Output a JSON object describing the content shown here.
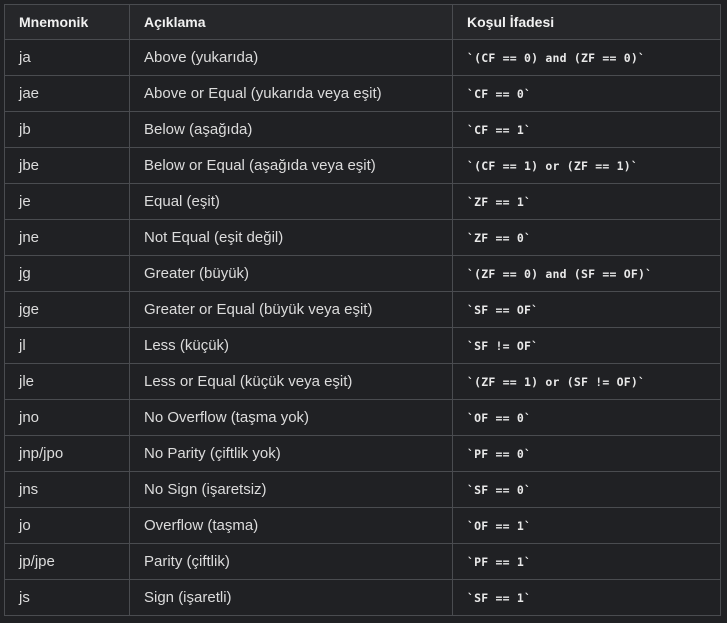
{
  "table": {
    "headers": [
      "Mnemonik",
      "Açıklama",
      "Koşul İfadesi"
    ],
    "rows": [
      [
        "ja",
        "Above (yukarıda)",
        "`(CF == 0) and (ZF == 0)`"
      ],
      [
        "jae",
        "Above or Equal (yukarıda veya eşit)",
        "`CF == 0`"
      ],
      [
        "jb",
        "Below (aşağıda)",
        "`CF == 1`"
      ],
      [
        "jbe",
        "Below or Equal (aşağıda veya eşit)",
        "`(CF == 1) or (ZF == 1)`"
      ],
      [
        "je",
        "Equal (eşit)",
        "`ZF == 1`"
      ],
      [
        "jne",
        "Not Equal (eşit değil)",
        "`ZF == 0`"
      ],
      [
        "jg",
        "Greater (büyük)",
        "`(ZF == 0) and (SF == OF)`"
      ],
      [
        "jge",
        "Greater or Equal (büyük veya eşit)",
        "`SF == OF`"
      ],
      [
        "jl",
        "Less (küçük)",
        "`SF != OF`"
      ],
      [
        "jle",
        "Less or Equal (küçük veya eşit)",
        "`(ZF == 1) or (SF != OF)`"
      ],
      [
        "jno",
        "No Overflow (taşma yok)",
        "`OF == 0`"
      ],
      [
        "jnp/jpo",
        "No Parity (çiftlik yok)",
        "`PF == 0`"
      ],
      [
        "jns",
        "No Sign (işaretsiz)",
        "`SF == 0`"
      ],
      [
        "jo",
        "Overflow (taşma)",
        "`OF == 1`"
      ],
      [
        "jp/jpe",
        "Parity (çiftlik)",
        "`PF == 1`"
      ],
      [
        "js",
        "Sign (işaretli)",
        "`SF == 1`"
      ]
    ]
  }
}
